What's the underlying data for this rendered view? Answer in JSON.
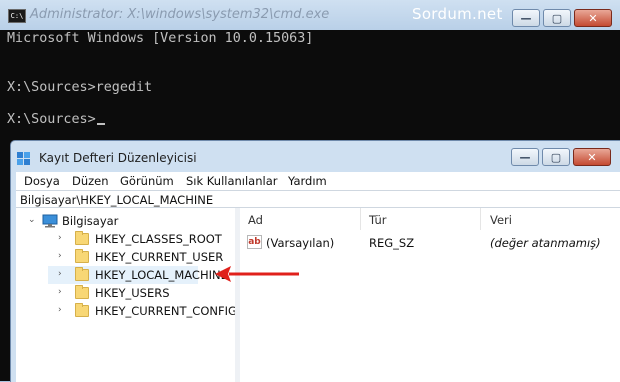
{
  "cmd": {
    "title": "Administrator: X:\\windows\\system32\\cmd.exe",
    "brand": "Sordum.net",
    "icon_text": "C:\\",
    "lines": [
      "Microsoft Windows [Version 10.0.15063]",
      "X:\\Sources>regedit",
      "X:\\Sources>"
    ],
    "buttons": {
      "minimize": "—",
      "maximize": "▢",
      "close": "✕"
    }
  },
  "regedit": {
    "title": "Kayıt Defteri Düzenleyicisi",
    "menu": [
      "Dosya",
      "Düzen",
      "Görünüm",
      "Sık Kullanılanlar",
      "Yardım"
    ],
    "address": "Bilgisayar\\HKEY_LOCAL_MACHINE",
    "buttons": {
      "minimize": "—",
      "maximize": "▢",
      "close": "✕"
    },
    "tree": {
      "root": "Bilgisayar",
      "expander_open": "⌄",
      "expander_closed": "›",
      "children": [
        "HKEY_CLASSES_ROOT",
        "HKEY_CURRENT_USER",
        "HKEY_LOCAL_MACHINE",
        "HKEY_USERS",
        "HKEY_CURRENT_CONFIG"
      ],
      "selected": "HKEY_LOCAL_MACHINE"
    },
    "columns": [
      "Ad",
      "Tür",
      "Veri"
    ],
    "values": [
      {
        "icon": "ab",
        "name": "(Varsayılan)",
        "type": "REG_SZ",
        "data": "(değer atanmamış)"
      }
    ]
  },
  "colors": {
    "console_bg": "#0c0c0c",
    "console_text": "#c0c0c0",
    "arrow": "#e0201b",
    "selection": "#e5f1fb"
  },
  "icons": [
    "cmd-icon",
    "regedit-icon",
    "computer-icon",
    "folder-icon",
    "string-value-icon",
    "arrow-icon"
  ]
}
